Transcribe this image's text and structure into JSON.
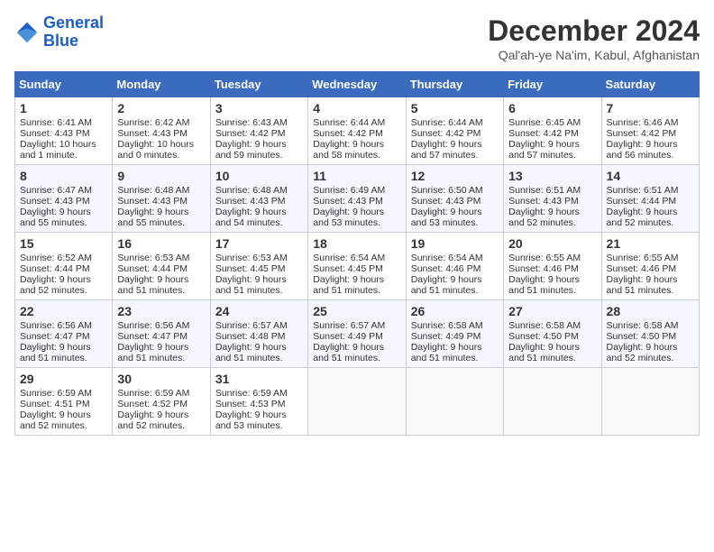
{
  "logo": {
    "line1": "General",
    "line2": "Blue"
  },
  "title": "December 2024",
  "subtitle": "Qal'ah-ye Na'im, Kabul, Afghanistan",
  "days_of_week": [
    "Sunday",
    "Monday",
    "Tuesday",
    "Wednesday",
    "Thursday",
    "Friday",
    "Saturday"
  ],
  "weeks": [
    [
      {
        "day": "1",
        "sunrise": "Sunrise: 6:41 AM",
        "sunset": "Sunset: 4:43 PM",
        "daylight": "Daylight: 10 hours and 1 minute."
      },
      {
        "day": "2",
        "sunrise": "Sunrise: 6:42 AM",
        "sunset": "Sunset: 4:43 PM",
        "daylight": "Daylight: 10 hours and 0 minutes."
      },
      {
        "day": "3",
        "sunrise": "Sunrise: 6:43 AM",
        "sunset": "Sunset: 4:42 PM",
        "daylight": "Daylight: 9 hours and 59 minutes."
      },
      {
        "day": "4",
        "sunrise": "Sunrise: 6:44 AM",
        "sunset": "Sunset: 4:42 PM",
        "daylight": "Daylight: 9 hours and 58 minutes."
      },
      {
        "day": "5",
        "sunrise": "Sunrise: 6:44 AM",
        "sunset": "Sunset: 4:42 PM",
        "daylight": "Daylight: 9 hours and 57 minutes."
      },
      {
        "day": "6",
        "sunrise": "Sunrise: 6:45 AM",
        "sunset": "Sunset: 4:42 PM",
        "daylight": "Daylight: 9 hours and 57 minutes."
      },
      {
        "day": "7",
        "sunrise": "Sunrise: 6:46 AM",
        "sunset": "Sunset: 4:42 PM",
        "daylight": "Daylight: 9 hours and 56 minutes."
      }
    ],
    [
      {
        "day": "8",
        "sunrise": "Sunrise: 6:47 AM",
        "sunset": "Sunset: 4:43 PM",
        "daylight": "Daylight: 9 hours and 55 minutes."
      },
      {
        "day": "9",
        "sunrise": "Sunrise: 6:48 AM",
        "sunset": "Sunset: 4:43 PM",
        "daylight": "Daylight: 9 hours and 55 minutes."
      },
      {
        "day": "10",
        "sunrise": "Sunrise: 6:48 AM",
        "sunset": "Sunset: 4:43 PM",
        "daylight": "Daylight: 9 hours and 54 minutes."
      },
      {
        "day": "11",
        "sunrise": "Sunrise: 6:49 AM",
        "sunset": "Sunset: 4:43 PM",
        "daylight": "Daylight: 9 hours and 53 minutes."
      },
      {
        "day": "12",
        "sunrise": "Sunrise: 6:50 AM",
        "sunset": "Sunset: 4:43 PM",
        "daylight": "Daylight: 9 hours and 53 minutes."
      },
      {
        "day": "13",
        "sunrise": "Sunrise: 6:51 AM",
        "sunset": "Sunset: 4:43 PM",
        "daylight": "Daylight: 9 hours and 52 minutes."
      },
      {
        "day": "14",
        "sunrise": "Sunrise: 6:51 AM",
        "sunset": "Sunset: 4:44 PM",
        "daylight": "Daylight: 9 hours and 52 minutes."
      }
    ],
    [
      {
        "day": "15",
        "sunrise": "Sunrise: 6:52 AM",
        "sunset": "Sunset: 4:44 PM",
        "daylight": "Daylight: 9 hours and 52 minutes."
      },
      {
        "day": "16",
        "sunrise": "Sunrise: 6:53 AM",
        "sunset": "Sunset: 4:44 PM",
        "daylight": "Daylight: 9 hours and 51 minutes."
      },
      {
        "day": "17",
        "sunrise": "Sunrise: 6:53 AM",
        "sunset": "Sunset: 4:45 PM",
        "daylight": "Daylight: 9 hours and 51 minutes."
      },
      {
        "day": "18",
        "sunrise": "Sunrise: 6:54 AM",
        "sunset": "Sunset: 4:45 PM",
        "daylight": "Daylight: 9 hours and 51 minutes."
      },
      {
        "day": "19",
        "sunrise": "Sunrise: 6:54 AM",
        "sunset": "Sunset: 4:46 PM",
        "daylight": "Daylight: 9 hours and 51 minutes."
      },
      {
        "day": "20",
        "sunrise": "Sunrise: 6:55 AM",
        "sunset": "Sunset: 4:46 PM",
        "daylight": "Daylight: 9 hours and 51 minutes."
      },
      {
        "day": "21",
        "sunrise": "Sunrise: 6:55 AM",
        "sunset": "Sunset: 4:46 PM",
        "daylight": "Daylight: 9 hours and 51 minutes."
      }
    ],
    [
      {
        "day": "22",
        "sunrise": "Sunrise: 6:56 AM",
        "sunset": "Sunset: 4:47 PM",
        "daylight": "Daylight: 9 hours and 51 minutes."
      },
      {
        "day": "23",
        "sunrise": "Sunrise: 6:56 AM",
        "sunset": "Sunset: 4:47 PM",
        "daylight": "Daylight: 9 hours and 51 minutes."
      },
      {
        "day": "24",
        "sunrise": "Sunrise: 6:57 AM",
        "sunset": "Sunset: 4:48 PM",
        "daylight": "Daylight: 9 hours and 51 minutes."
      },
      {
        "day": "25",
        "sunrise": "Sunrise: 6:57 AM",
        "sunset": "Sunset: 4:49 PM",
        "daylight": "Daylight: 9 hours and 51 minutes."
      },
      {
        "day": "26",
        "sunrise": "Sunrise: 6:58 AM",
        "sunset": "Sunset: 4:49 PM",
        "daylight": "Daylight: 9 hours and 51 minutes."
      },
      {
        "day": "27",
        "sunrise": "Sunrise: 6:58 AM",
        "sunset": "Sunset: 4:50 PM",
        "daylight": "Daylight: 9 hours and 51 minutes."
      },
      {
        "day": "28",
        "sunrise": "Sunrise: 6:58 AM",
        "sunset": "Sunset: 4:50 PM",
        "daylight": "Daylight: 9 hours and 52 minutes."
      }
    ],
    [
      {
        "day": "29",
        "sunrise": "Sunrise: 6:59 AM",
        "sunset": "Sunset: 4:51 PM",
        "daylight": "Daylight: 9 hours and 52 minutes."
      },
      {
        "day": "30",
        "sunrise": "Sunrise: 6:59 AM",
        "sunset": "Sunset: 4:52 PM",
        "daylight": "Daylight: 9 hours and 52 minutes."
      },
      {
        "day": "31",
        "sunrise": "Sunrise: 6:59 AM",
        "sunset": "Sunset: 4:53 PM",
        "daylight": "Daylight: 9 hours and 53 minutes."
      },
      null,
      null,
      null,
      null
    ]
  ]
}
